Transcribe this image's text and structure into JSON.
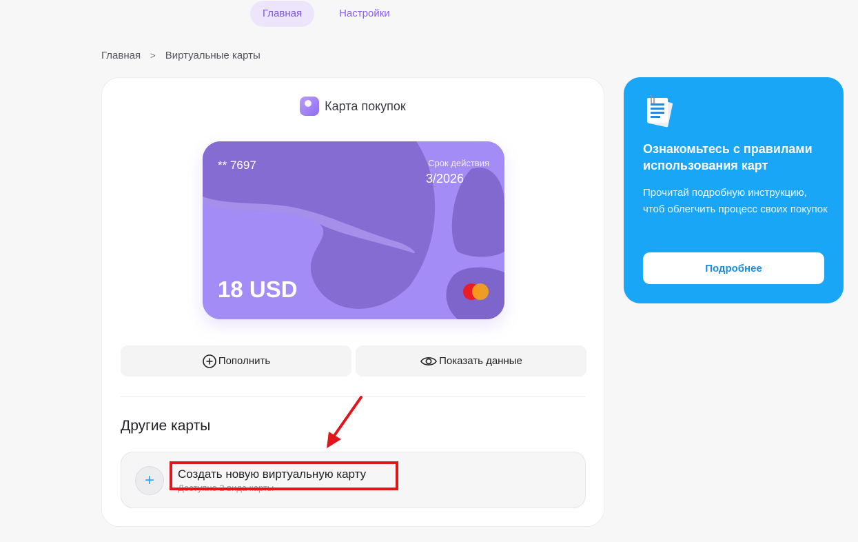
{
  "nav": {
    "tabs": [
      {
        "label": "Главная",
        "active": true
      },
      {
        "label": "Настройки",
        "active": false
      }
    ]
  },
  "breadcrumb": {
    "items": [
      "Главная",
      "Виртуальные карты"
    ],
    "separator": ">"
  },
  "card_panel": {
    "title": "Карта покупок",
    "title_icon": "purchase-card-icon",
    "card": {
      "number": "** 7697",
      "expiry_label": "Срок действия",
      "expiry": "3/2026",
      "amount": "18 USD",
      "network_icon": "mastercard-icon",
      "colors": {
        "base": "#a58ef7",
        "dark": "#7c62c8"
      }
    },
    "actions": [
      {
        "label": "Пополнить",
        "icon": "plus-circle-icon"
      },
      {
        "label": "Показать данные",
        "icon": "eye-icon"
      }
    ],
    "other_cards": {
      "title": "Другие карты",
      "create": {
        "title": "Создать новую виртуальную карту",
        "subtitle": "Доступно 2 вида карты"
      }
    }
  },
  "info_panel": {
    "icon": "document-icon",
    "title": "Ознакомьтесь с правилами использования карт",
    "text": "Прочитай подробную инструкцию, чтоб облегчить процесс своих покупок",
    "button": "Подробнее",
    "color": "#1aa6f7"
  },
  "annotation": {
    "color": "#e0161b"
  }
}
